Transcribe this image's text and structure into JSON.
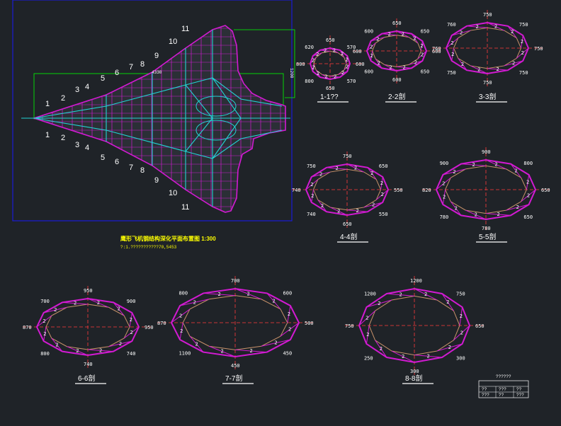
{
  "drawing": {
    "plan_title": "鹰形飞机钢结构深化平面布置图 1:300",
    "plan_subtitle": "?:1.???????????70,5453",
    "colors": {
      "background": "#1f2328",
      "frame": "#1b1bd6",
      "member": "#d21ad2",
      "grid": "#22d3d3",
      "dim": "#ff3b3b",
      "box": "#00ff00",
      "text": "#ffffff",
      "title": "#ffff00"
    },
    "plan_top_marks": [
      "1",
      "2",
      "3",
      "4",
      "5",
      "6",
      "7",
      "8",
      "9",
      "10",
      "11"
    ],
    "plan_bottom_marks": [
      "1",
      "2",
      "3",
      "4",
      "5",
      "6",
      "7",
      "8",
      "9",
      "10",
      "11"
    ],
    "side_dim": "1200",
    "plan_mid_label": "4330"
  },
  "sections": [
    {
      "label": "1-1??",
      "dims": [
        "650",
        "570",
        "600",
        "570",
        "650",
        "800",
        "800",
        "620"
      ]
    },
    {
      "label": "2-2剖",
      "dims": [
        "650",
        "650",
        "600",
        "650",
        "600",
        "600",
        "600",
        "600"
      ]
    },
    {
      "label": "3-3剖",
      "dims": [
        "750",
        "750",
        "750",
        "750",
        "750",
        "750",
        "760",
        "760"
      ]
    },
    {
      "label": "4-4剖",
      "dims": [
        "750",
        "650",
        "550",
        "550",
        "650",
        "740",
        "740",
        "750"
      ]
    },
    {
      "label": "5-5剖",
      "dims": [
        "900",
        "800",
        "650",
        "650",
        "780",
        "780",
        "820",
        "900"
      ]
    },
    {
      "label": "6-6剖",
      "dims": [
        "950",
        "900",
        "950",
        "740",
        "740",
        "800",
        "870",
        "700"
      ]
    },
    {
      "label": "7-7剖",
      "dims": [
        "700",
        "600",
        "500",
        "450",
        "450",
        "1100",
        "870",
        "800"
      ]
    },
    {
      "label": "8-8剖",
      "dims": [
        "1200",
        "750",
        "650",
        "300",
        "300",
        "250",
        "750",
        "1200"
      ]
    }
  ],
  "title_block": {
    "header": "??????",
    "rows": [
      "??",
      "???",
      "??",
      "???",
      "??",
      "???"
    ]
  }
}
